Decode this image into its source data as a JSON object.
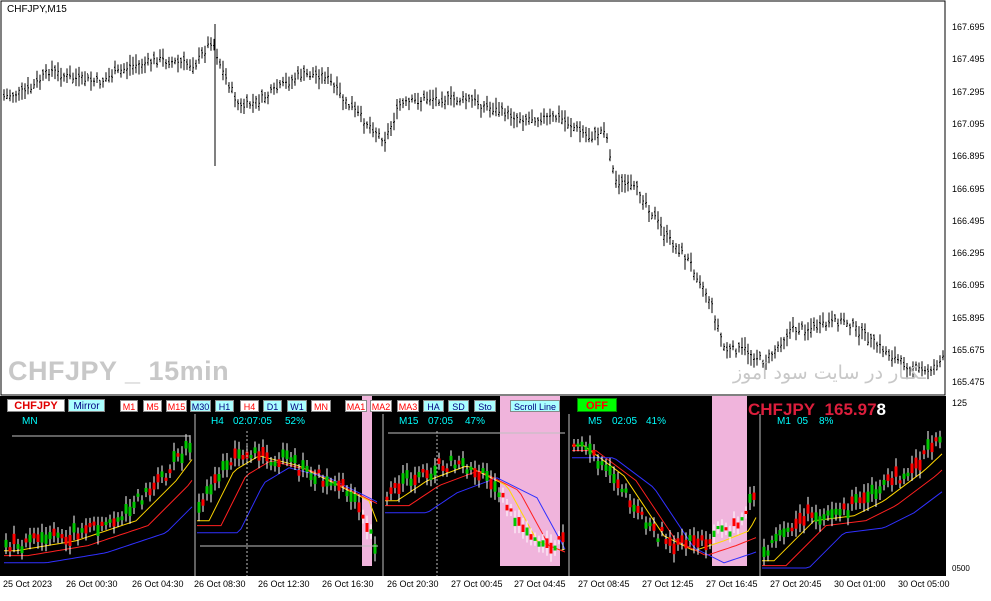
{
  "chart": {
    "symbol_timeframe": "CHFJPY,M15",
    "watermark": "CHFJPY _ 15min",
    "persian_watermark": "مرجع دانلود اکسپرت و اندیکاتور در سایت سود آموز",
    "persian_watermark_visible": "ـکـار در سایت سود آموز",
    "price_axis": [
      "167.695",
      "167.495",
      "167.295",
      "167.095",
      "166.895",
      "166.695",
      "166.495",
      "166.295",
      "166.095",
      "165.895",
      "165.675",
      "165.475"
    ],
    "sub_axis": [
      "125",
      "0",
      "500"
    ],
    "time_axis": [
      "25 Oct 2023",
      "26 Oct 00:30",
      "26 Oct 04:30",
      "26 Oct 08:30",
      "26 Oct 12:30",
      "26 Oct 16:30",
      "26 Oct 20:30",
      "27 Oct 00:45",
      "27 Oct 04:45",
      "27 Oct 08:45",
      "27 Oct 12:45",
      "27 Oct 16:45",
      "27 Oct 20:45",
      "30 Oct 01:00",
      "30 Oct 05:00"
    ]
  },
  "panel": {
    "buttons": {
      "symbol": "CHFJPY",
      "mirror": "Mirror",
      "tf": [
        "M1",
        "M5",
        "M15",
        "M30",
        "H1",
        "H4",
        "D1",
        "W1",
        "MN"
      ],
      "ma": [
        "MA1",
        "MA2",
        "MA3"
      ],
      "tools": [
        "HA",
        "SD",
        "Sto"
      ],
      "scroll": "Scroll Line",
      "toggle": "OFF"
    },
    "big_symbol": "CHFJPY",
    "big_price_main": "165.97",
    "big_price_last": "8",
    "sub1": {
      "tf": "MN"
    },
    "sub2": {
      "tf": "H4",
      "timer": "02:07:05",
      "pct": "52%"
    },
    "sub3": {
      "tf": "M15",
      "timer": "07:05",
      "pct": "47%"
    },
    "sub4": {
      "tf": "M5",
      "timer": "02:05",
      "pct": "41%"
    },
    "sub5": {
      "tf": "M1",
      "timer": "05",
      "pct": "8%"
    }
  },
  "colors": {
    "bull": "#00c800",
    "bear": "#ff0000",
    "ma_fast": "#ffd700",
    "ma_mid": "#ff2020",
    "ma_slow": "#3030ff",
    "highlight": "#f0b4dc",
    "panel_bg": "#000000",
    "label": "#00ffff"
  }
}
